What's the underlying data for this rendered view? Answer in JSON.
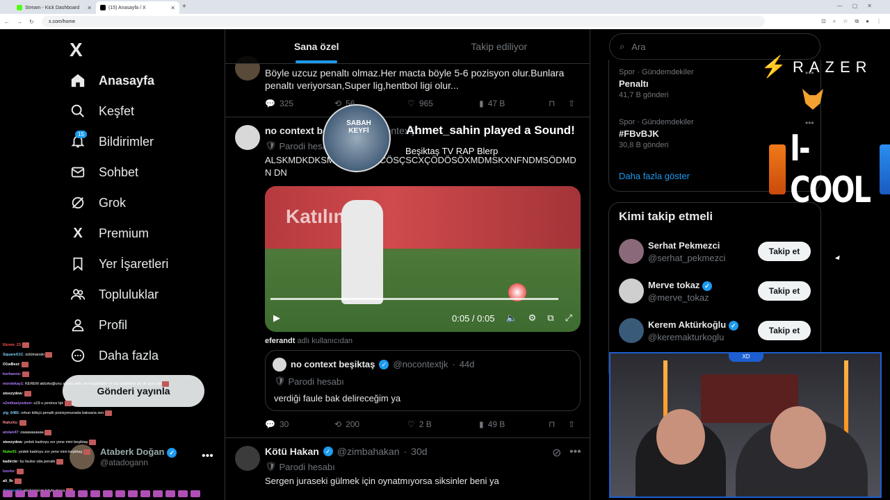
{
  "browser": {
    "tabs": [
      {
        "title": "Stream - Kick Dashboard",
        "favicon_color": "#53fc18"
      },
      {
        "title": "(15) Anasayfa / X",
        "favicon_color": "#000000"
      }
    ],
    "url": "x.com/home"
  },
  "sidebar": {
    "logo": "X",
    "items": [
      {
        "label": "Anasayfa",
        "icon": "home-icon"
      },
      {
        "label": "Keşfet",
        "icon": "search-icon"
      },
      {
        "label": "Bildirimler",
        "icon": "bell-icon",
        "badge": "15"
      },
      {
        "label": "Sohbet",
        "icon": "mail-icon"
      },
      {
        "label": "Grok",
        "icon": "grok-icon"
      },
      {
        "label": "Premium",
        "icon": "x-icon"
      },
      {
        "label": "Yer İşaretleri",
        "icon": "bookmark-icon"
      },
      {
        "label": "Topluluklar",
        "icon": "people-icon"
      },
      {
        "label": "Profil",
        "icon": "person-icon"
      },
      {
        "label": "Daha fazla",
        "icon": "more-circle-icon"
      }
    ],
    "post_button": "Gönderi yayınla",
    "account": {
      "name": "Ataberk Doğan",
      "handle": "@atadogann"
    }
  },
  "feed": {
    "tabs": [
      "Sana özel",
      "Takip ediliyor"
    ],
    "tweets": [
      {
        "text": "Böyle uzcuz penaltı olmaz.Her macta böyle 5-6 pozisyon olur.Bunlara penaltı veriyorsan,Super lig,hentbol ligi olur...",
        "replies": "325",
        "retweets": "56",
        "likes": "965",
        "views": "47 B"
      },
      {
        "name": "no context beşiktaş",
        "handle": "@nocontextjk",
        "parody": "Parodi hesabı",
        "text": "ALSKMDKDKSMDKSMCÇSCÖSÇSCXÇÖDÖSÖXMDMSKXNFNDMSÖDMDN DN",
        "video_time": "0:05 / 0:05",
        "video_banner": "Katılım",
        "credit": "eferandt",
        "credit_suffix": "adlı kullanıcıdan",
        "quote": {
          "name": "no context beşiktaş",
          "handle": "@nocontextjk",
          "time": "44d",
          "parody": "Parodi hesabı",
          "text": "verdiği faule bak delireceğim ya"
        },
        "replies": "30",
        "retweets": "200",
        "likes": "2 B",
        "views": "49 B"
      },
      {
        "name": "Kötü Hakan",
        "handle": "@zimbahakan",
        "time": "30d",
        "parody": "Parodi hesabı",
        "text": "Sergen juraseki gülmek için oynatmıyorsa siksinler beni ya"
      }
    ]
  },
  "right": {
    "search_placeholder": "Ara",
    "trends": [
      {
        "category": "Spor · Gündemdekiler",
        "name": "Penaltı",
        "count": "41,7 B gönderi"
      },
      {
        "category": "Spor · Gündemdekiler",
        "name": "#FBvBJK",
        "count": "30,8 B gönderi"
      }
    ],
    "show_more": "Daha fazla göster",
    "who_to_follow_title": "Kimi takip etmeli",
    "who_to_follow": [
      {
        "name": "Serhat Pekmezci",
        "handle": "@serhat_pekmezci",
        "verified": false,
        "button": "Takip et"
      },
      {
        "name": "Merve tokaz",
        "handle": "@merve_tokaz",
        "verified": true,
        "button": "Takip et"
      },
      {
        "name": "Kerem Aktürkoğlu",
        "handle": "@keremakturkoglu",
        "verified": true,
        "button": "Takip et"
      }
    ]
  },
  "stream_overlay": {
    "alert_title": "Ahmet_sahin played a Sound!",
    "alert_sub": "Beşiktaş TV RAP Blerp",
    "alert_pic_text": "SABAH KEYFİ",
    "sponsor1": "RAZER",
    "sponsor2": "I-COOL",
    "cam_tag": "XD",
    "chat": [
      {
        "user": "Ekrem_23",
        "msg": "",
        "color": "#ff4d4d"
      },
      {
        "user": "SquareX1C",
        "msg": ": sülümanski",
        "color": "#7fd4ff"
      },
      {
        "user": "O1wBest",
        "msg": ":",
        "color": "#ffffff"
      },
      {
        "user": "korhanne",
        "msg": ":",
        "color": "#b07cff"
      },
      {
        "user": "mordekay1",
        "msg": ": KEREM aktürkoğlunu alanın amk. ne koşabiliyor ne top tutabiliyor ne de aya çöp",
        "color": "#b07cff"
      },
      {
        "user": "steezydew",
        "msg": ":",
        "color": "#ffffff"
      },
      {
        "user": "s2mikasiyodum",
        "msg": ": u19 u yenince bjk",
        "color": "#b07cff"
      },
      {
        "user": "yig_6481",
        "msg": ": orkun kökçü penaltı pozisyonunada baksana sen",
        "color": "#7fd4ff"
      },
      {
        "user": "RahoXs",
        "msg": ":",
        "color": "#ff8c8c"
      },
      {
        "user": "atolan47",
        "msg": ": zaaaaaaaaaa",
        "color": "#b07cff"
      },
      {
        "user": "steezydew",
        "msg": ": yedek kadroyu zor yene mini beşiktaş",
        "color": "#ffffff"
      },
      {
        "user": "Nuke01",
        "msg": ": yedek kadroyu zor yene mini beşiktaş",
        "color": "#53fc18"
      },
      {
        "user": "kadirckr",
        "msg": ": bu faulse oda penaltı",
        "color": "#ffffff"
      },
      {
        "user": "loorke",
        "msg": ":",
        "color": "#b07cff"
      },
      {
        "user": "ali_fb",
        "msg": ":",
        "color": "#ffffff"
      },
      {
        "user": "Alperen57",
        "msg": ": abi başlarım böyle maça",
        "color": "#1d9bf0"
      }
    ]
  }
}
